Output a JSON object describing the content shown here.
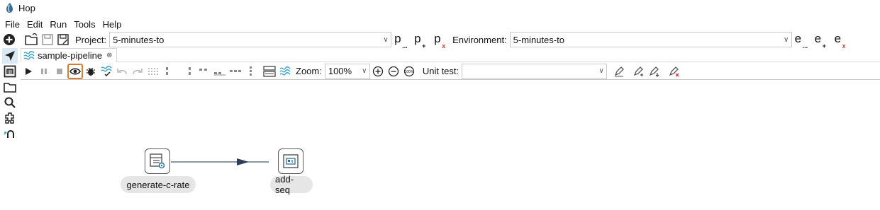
{
  "app": {
    "title": "Hop"
  },
  "menu": {
    "items": [
      "File",
      "Edit",
      "Run",
      "Tools",
      "Help"
    ]
  },
  "projectbar": {
    "project_label": "Project:",
    "project_value": "5-minutes-to",
    "environment_label": "Environment:",
    "environment_value": "5-minutes-to",
    "project_buttons": [
      {
        "letter": "p",
        "sub": "..."
      },
      {
        "letter": "p",
        "sub": "+"
      },
      {
        "letter": "p",
        "sub": "x"
      }
    ],
    "environment_buttons": [
      {
        "letter": "e",
        "sub": "..."
      },
      {
        "letter": "e",
        "sub": "+"
      },
      {
        "letter": "e",
        "sub": "x"
      }
    ]
  },
  "tab": {
    "label": "sample-pipeline",
    "close": "⊗"
  },
  "toolbar": {
    "zoom_label": "Zoom:",
    "zoom_value": "100%",
    "unit_test_label": "Unit test:",
    "unit_test_value": "",
    "zoom_100_text": "100%"
  },
  "canvas": {
    "nodes": [
      {
        "name": "generate-c-rate",
        "icon": "row-generator-icon"
      },
      {
        "name": "add-seq",
        "icon": "add-sequence-icon"
      }
    ]
  },
  "colors": {
    "highlight": "#e07a2a",
    "play": "#333333",
    "hop_blue": "#3aa3c9",
    "delete_red": "#d23a3a"
  }
}
